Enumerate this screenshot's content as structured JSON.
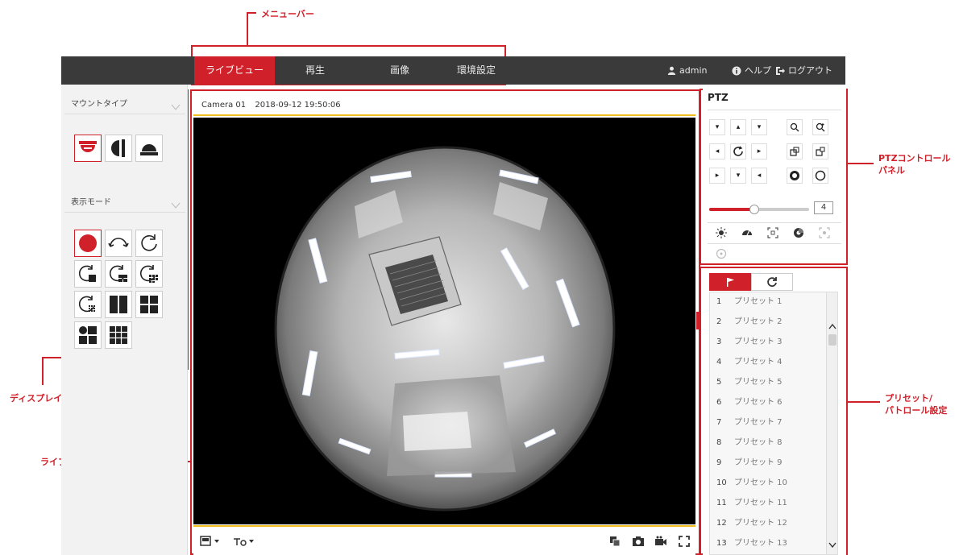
{
  "annotations": {
    "menubar": "メニューバー",
    "ptz_control_line1": "PTZコントロール",
    "ptz_control_line2": "パネル",
    "display_control": "ディスプレイコントロール",
    "liveview_window": "ライブビューウインドウ",
    "preset_line1": "プリセット/",
    "preset_line2": "パトロール設定"
  },
  "menu": {
    "tabs": [
      {
        "label": "ライブビュー",
        "active": true
      },
      {
        "label": "再生",
        "active": false
      },
      {
        "label": "画像",
        "active": false
      },
      {
        "label": "環境設定",
        "active": false
      }
    ],
    "user": "admin",
    "help": "ヘルプ",
    "logout": "ログアウト"
  },
  "left": {
    "mount_type": "マウントタイプ",
    "display_mode": "表示モード"
  },
  "live": {
    "camera": "Camera 01",
    "timestamp": "2018-09-12 19:50:06"
  },
  "ptz": {
    "title": "PTZ",
    "speed": "4",
    "speed_fraction": 0.45
  },
  "presets": {
    "items": [
      {
        "num": "1",
        "name": "プリセット 1"
      },
      {
        "num": "2",
        "name": "プリセット 2"
      },
      {
        "num": "3",
        "name": "プリセット 3"
      },
      {
        "num": "4",
        "name": "プリセット 4"
      },
      {
        "num": "5",
        "name": "プリセット 5"
      },
      {
        "num": "6",
        "name": "プリセット 6"
      },
      {
        "num": "7",
        "name": "プリセット 7"
      },
      {
        "num": "8",
        "name": "プリセット 8"
      },
      {
        "num": "9",
        "name": "プリセット 9"
      },
      {
        "num": "10",
        "name": "プリセット 10"
      },
      {
        "num": "11",
        "name": "プリセット 11"
      },
      {
        "num": "12",
        "name": "プリセット 12"
      },
      {
        "num": "13",
        "name": "プリセット 13"
      }
    ]
  },
  "colors": {
    "accent": "#d0202a",
    "menubar_bg": "#3a3a3a",
    "highlight_line": "#f0c020"
  }
}
